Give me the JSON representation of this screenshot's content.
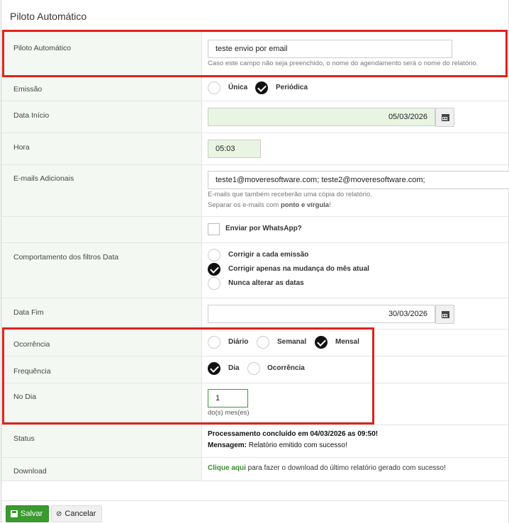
{
  "modal": {
    "title": "Piloto Automático"
  },
  "fields": {
    "piloto": {
      "label": "Piloto Automático",
      "value": "teste envio por email",
      "help": "Caso este campo não seja preenchido, o nome do agendamento será o nome do relatório."
    },
    "emissao": {
      "label": "Emissão",
      "options": [
        "Única",
        "Periódica"
      ],
      "selected": "Periódica"
    },
    "data_inicio": {
      "label": "Data Início",
      "value": "05/03/2026"
    },
    "hora": {
      "label": "Hora",
      "value": "05:03"
    },
    "emails": {
      "label": "E-mails Adicionais",
      "value": "teste1@moveresoftware.com; teste2@moveresoftware.com;",
      "help1": "E-mails que também receberão uma cópia do relatório.",
      "help2_pre": "Separar os e-mails com ",
      "help2_bold": "ponto e vírgula",
      "help2_post": "!"
    },
    "whatsapp": {
      "label": "Enviar por WhatsApp?",
      "checked": false
    },
    "comportamento": {
      "label": "Comportamento dos filtros Data",
      "options": [
        "Corrigir a cada emissão",
        "Corrigir apenas na mudança do mês atual",
        "Nunca alterar as datas"
      ],
      "selected": "Corrigir apenas na mudança do mês atual"
    },
    "data_fim": {
      "label": "Data Fim",
      "value": "30/03/2026"
    },
    "ocorrencia": {
      "label": "Ocorrência",
      "options": [
        "Diário",
        "Semanal",
        "Mensal"
      ],
      "selected": "Mensal"
    },
    "frequencia": {
      "label": "Frequência",
      "options": [
        "Dia",
        "Ocorrência"
      ],
      "selected": "Dia"
    },
    "no_dia": {
      "label": "No Dia",
      "value": "1",
      "help": "do(s) mes(es)"
    },
    "status": {
      "label": "Status",
      "line1": "Processamento concluído em 04/03/2026 as 09:50!",
      "line2_bold": "Mensagem:",
      "line2_text": " Relatório emitido com sucesso!"
    },
    "download": {
      "label": "Download",
      "link": "Clique aqui",
      "text": " para fazer o download do último relatório gerado com sucesso!"
    }
  },
  "footer": {
    "save_label": "Salvar",
    "cancel_label": "Cancelar"
  },
  "colors": {
    "highlight": "#e0221c",
    "primary": "#3a9a2e",
    "label_bg": "#f4f8f2"
  }
}
